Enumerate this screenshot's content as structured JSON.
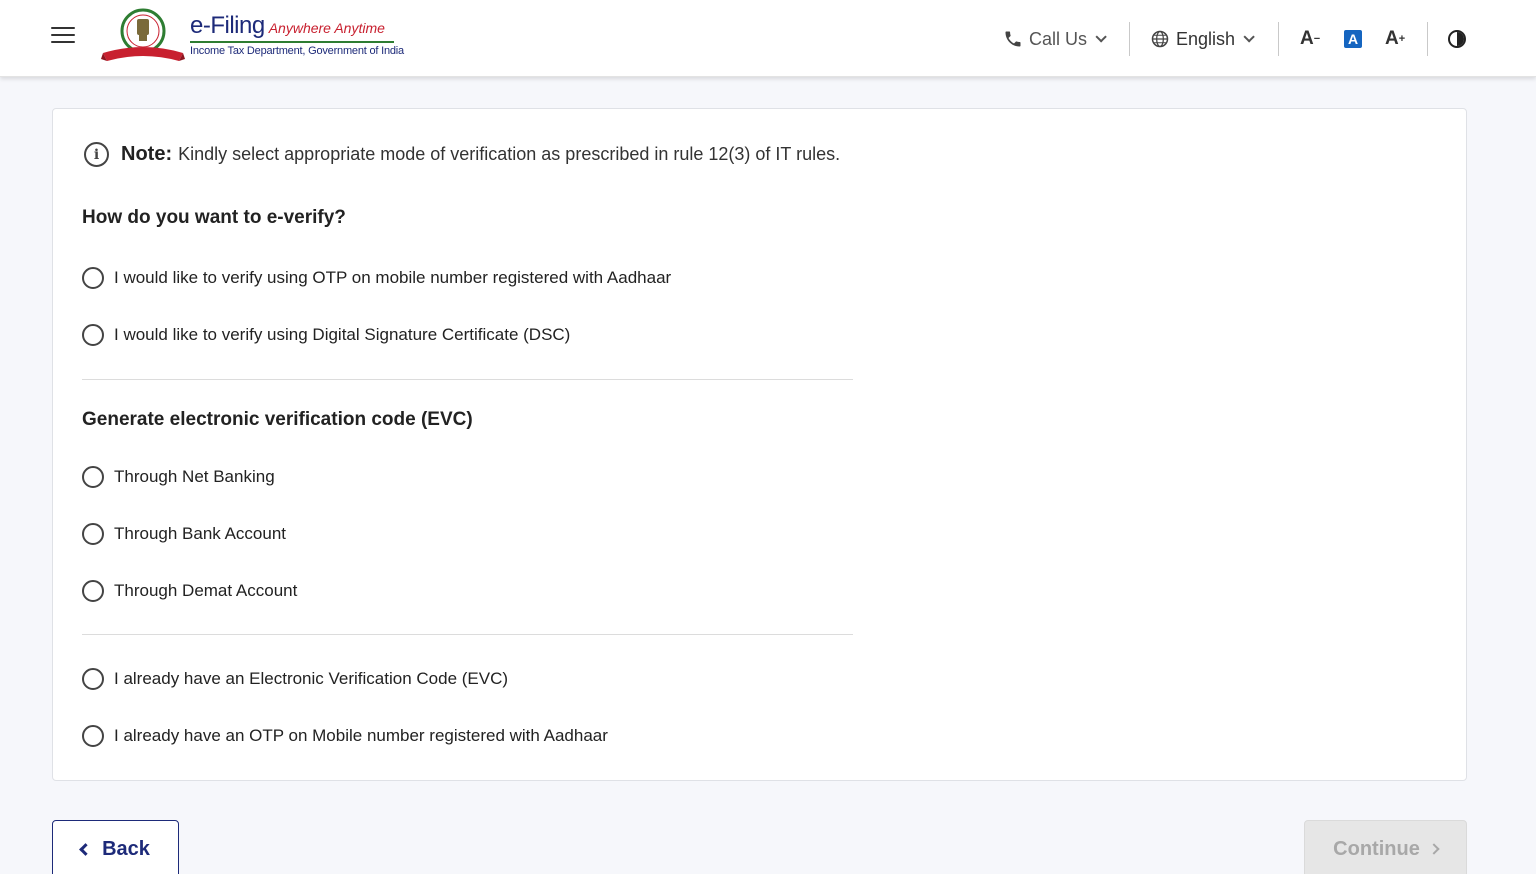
{
  "header": {
    "logo_title": "e-Filing",
    "logo_tagline": "Anywhere Anytime",
    "logo_subtitle": "Income Tax Department, Government of India",
    "emblem_text": "INCOME TAX DEPARTMENT",
    "call_us_label": "Call Us",
    "language_label": "English",
    "font_decrease_label": "A",
    "font_default_label": "A",
    "font_increase_label": "A",
    "icons": [
      "menu-icon",
      "phone-icon",
      "globe-icon",
      "chevron-down-icon",
      "contrast-icon"
    ],
    "accent_color": "#1565c0",
    "brand_color": "#1d2a79"
  },
  "note": {
    "label": "Note:",
    "text": "Kindly select appropriate mode of verification as prescribed in rule 12(3) of IT rules."
  },
  "everify": {
    "title": "How do you want to e-verify?",
    "options": [
      "I would like to verify using OTP on mobile number registered with Aadhaar",
      "I would like to verify using Digital Signature Certificate (DSC)"
    ]
  },
  "evc": {
    "title": "Generate electronic verification code (EVC)",
    "options": [
      "Through Net Banking",
      "Through Bank Account",
      "Through Demat Account"
    ]
  },
  "existing": {
    "options": [
      "I already have an Electronic Verification Code (EVC)",
      "I already have an OTP on Mobile number registered with Aadhaar"
    ]
  },
  "footer": {
    "back_label": "Back",
    "continue_label": "Continue"
  }
}
